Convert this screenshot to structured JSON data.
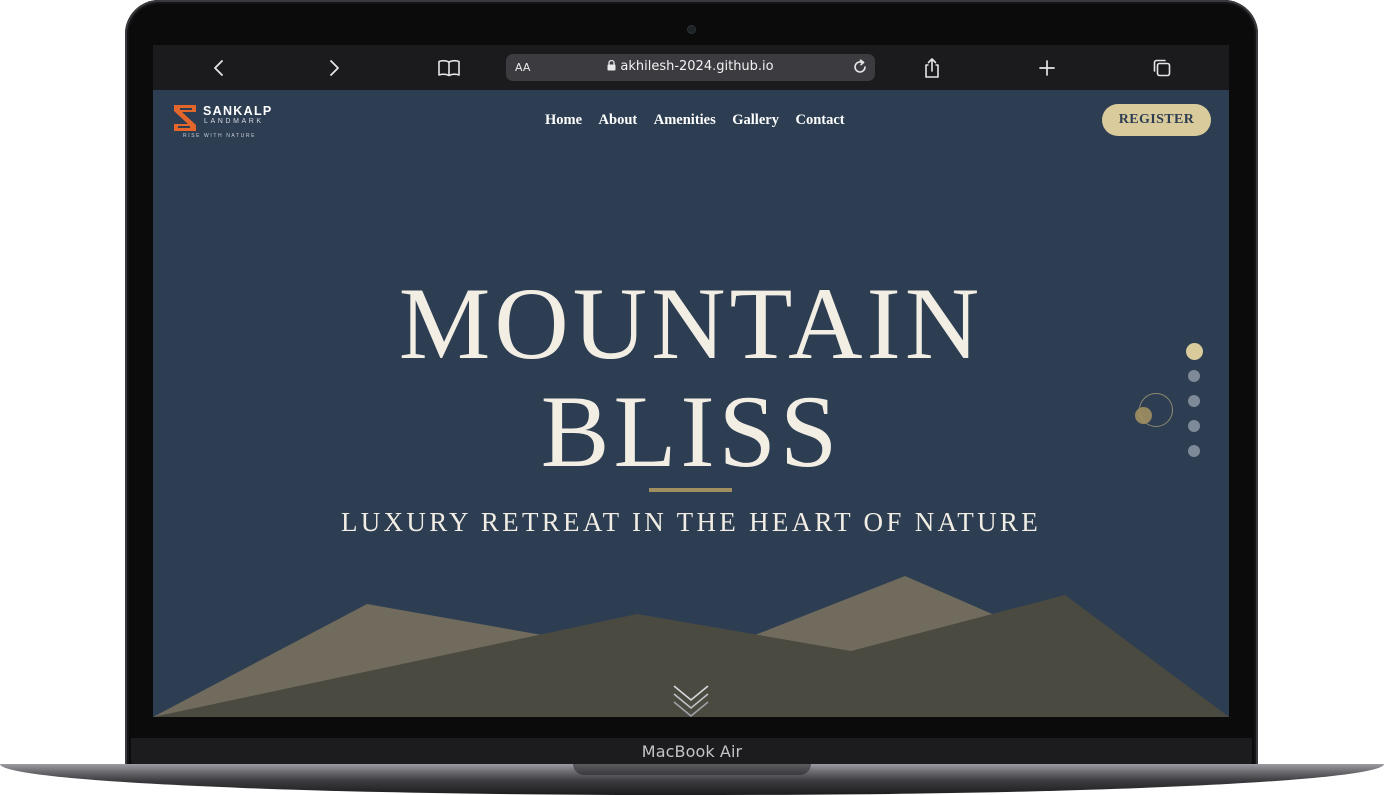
{
  "device": {
    "label": "MacBook Air"
  },
  "browser": {
    "text_size_label": "AA",
    "url": "akhilesh-2024.github.io",
    "icons": [
      "back-icon",
      "forward-icon",
      "bookmarks-icon",
      "lock-icon",
      "reload-icon",
      "share-icon",
      "new-tab-icon",
      "tabs-icon"
    ]
  },
  "site": {
    "logo": {
      "name": "SANKALP",
      "sub": "LANDMARK",
      "tagline": "RISE WITH NATURE"
    },
    "nav": [
      {
        "label": "Home"
      },
      {
        "label": "About"
      },
      {
        "label": "Amenities"
      },
      {
        "label": "Gallery"
      },
      {
        "label": "Contact"
      }
    ],
    "register_label": "REGISTER",
    "hero": {
      "title_line1": "MOUNTAIN",
      "title_line2": "BLISS",
      "subtitle": "LUXURY RETREAT IN THE HEART OF NATURE"
    },
    "slides": {
      "count": 5,
      "active_index": 0
    }
  },
  "colors": {
    "site_background": "#2d3e53",
    "accent_gold": "#d9cb9b",
    "divider_gold": "#a18f60",
    "mountain_front": "#706b5c",
    "mountain_back": "#4b4a41",
    "browser_toolbar": "#1b1b1d",
    "logo_orange": "#e5662b"
  }
}
